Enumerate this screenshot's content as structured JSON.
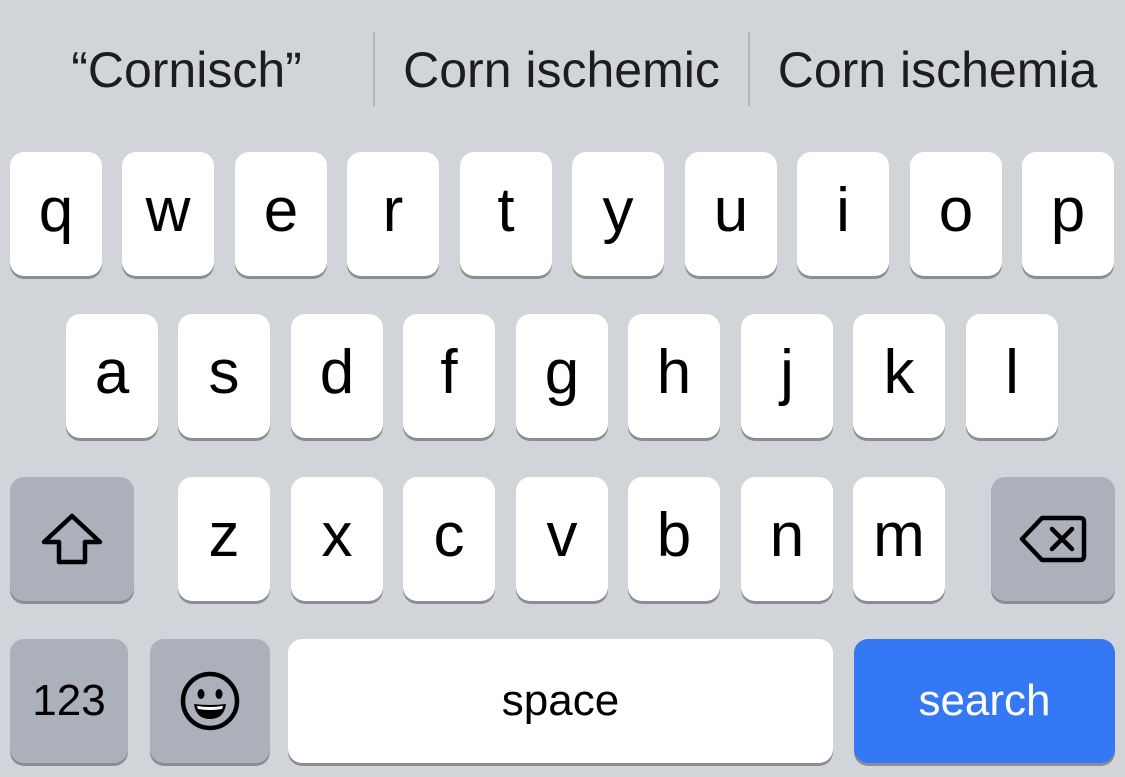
{
  "suggestions": [
    {
      "label": "“Cornisch”"
    },
    {
      "label": "Corn ischemic"
    },
    {
      "label": "Corn ischemia"
    }
  ],
  "rows": {
    "row1": [
      "q",
      "w",
      "e",
      "r",
      "t",
      "y",
      "u",
      "i",
      "o",
      "p"
    ],
    "row2": [
      "a",
      "s",
      "d",
      "f",
      "g",
      "h",
      "j",
      "k",
      "l"
    ],
    "row3": [
      "z",
      "x",
      "c",
      "v",
      "b",
      "n",
      "m"
    ]
  },
  "bottom": {
    "numbers_label": "123",
    "space_label": "space",
    "search_label": "search"
  },
  "icons": {
    "shift": "shift-icon",
    "delete": "delete-icon",
    "emoji": "emoji-icon"
  },
  "colors": {
    "background": "#d1d4d9",
    "key": "#ffffff",
    "function_key": "#abb0ba",
    "search_key": "#3478f6"
  }
}
